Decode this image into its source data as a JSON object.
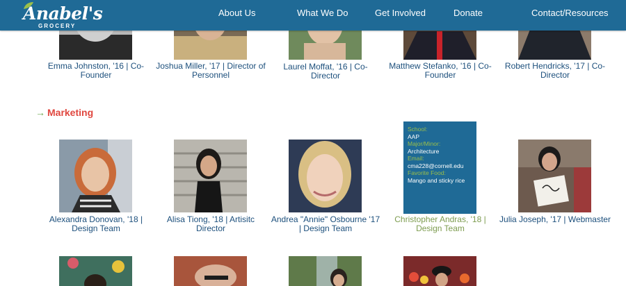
{
  "header": {
    "logo_text": "Anabel's",
    "logo_sub": "GROCERY",
    "nav": [
      "About Us",
      "What We Do",
      "Get Involved",
      "Donate",
      "Contact/Resources"
    ]
  },
  "top_row": [
    {
      "line1": "Emma Johnston, '16 | Co-",
      "line2": "Founder"
    },
    {
      "line1": "Joshua Miller, '17 | Director of",
      "line2": "Personnel"
    },
    {
      "line1": "Laurel Moffat, '16 | Co-",
      "line2": "Director"
    },
    {
      "line1": "Matthew Stefanko, '16 | Co-",
      "line2": "Founder"
    },
    {
      "line1": "Robert Hendricks, '17 | Co-",
      "line2": "Director"
    }
  ],
  "section": {
    "arrow": "→",
    "title": "Marketing"
  },
  "marketing": [
    {
      "line1": "Alexandra Donovan, '18 |",
      "line2": "Design Team"
    },
    {
      "line1": "Alisa Tiong, '18 | Artisitc",
      "line2": "Director"
    },
    {
      "line1": "Andrea \"Annie\" Osbourne '17",
      "line2": "| Design Team"
    },
    {
      "line1": "Christopher Andras, '18 |",
      "line2": "Design Team"
    },
    {
      "line1": "Julia Joseph, '17 | Webmaster",
      "line2": ""
    }
  ],
  "info_card": {
    "school_label": "School:",
    "school": "AAP",
    "major_label": "Major/Minor:",
    "major": "Architecture",
    "email_label": "Email:",
    "email": "cma228@cornell.edu",
    "food_label": "Favorite Food:",
    "food": "Mango and sticky rice"
  },
  "colors": {
    "header_bg": "#1f6a96",
    "caption": "#1c4f7c",
    "caption_active": "#7d9c4f",
    "section_title": "#e0473f",
    "section_arrow": "#6aa84f"
  }
}
